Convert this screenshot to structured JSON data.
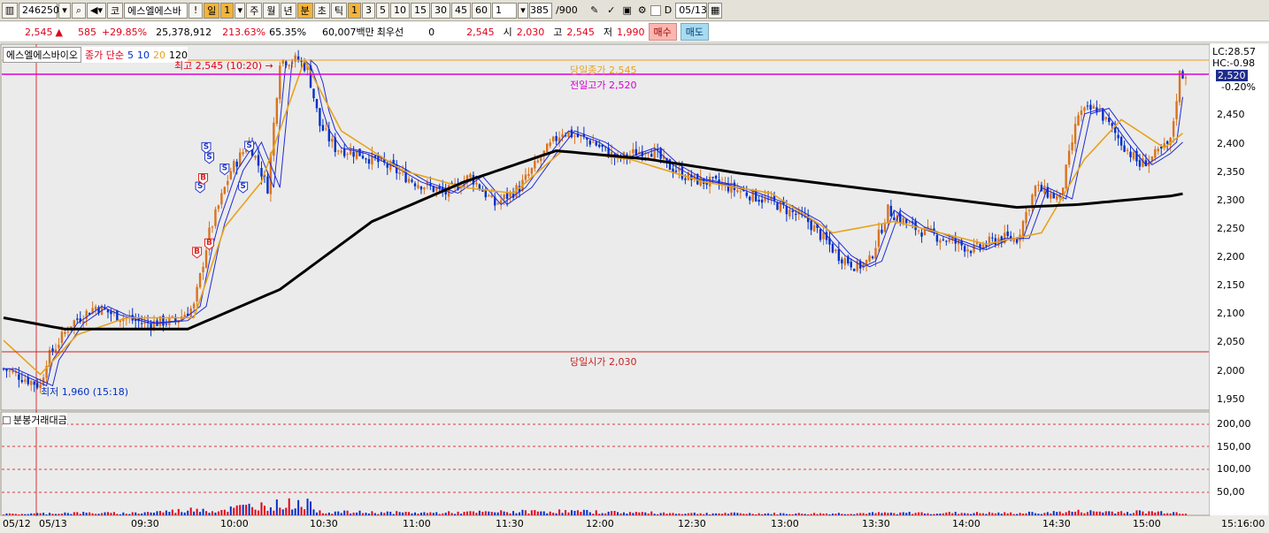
{
  "toolbar": {
    "code": "246250",
    "market_btn": "코",
    "stock_name": "에스엘에스바",
    "alert_btn": "!",
    "period_day": "일",
    "period_day_num": "1",
    "period_week": "주",
    "period_month": "월",
    "period_year": "년",
    "period_min": "분",
    "period_tick": "초",
    "period_tick2": "틱",
    "intervals": [
      "1",
      "3",
      "5",
      "10",
      "15",
      "30",
      "45",
      "60"
    ],
    "interval_value": "1",
    "count_value": "385",
    "count_total": "/900",
    "date_value": "05/13"
  },
  "quote": {
    "price": "2,545",
    "change": "585",
    "change_pct": "+29.85%",
    "volume": "25,378,912",
    "volume_ratio": "213.63%",
    "rate": "65.35%",
    "amount": "60,007백만",
    "best_label": "최우선",
    "best_value": "0",
    "last": "2,545",
    "open_label": "시",
    "open": "2,030",
    "high_label": "고",
    "high": "2,545",
    "low_label": "저",
    "low": "1,990",
    "buy_button": "매수",
    "sell_button": "매도"
  },
  "legend": {
    "stock": "에스엘에스바이오",
    "ma_label": "종가 단순",
    "ma_periods": [
      "5",
      "10",
      "20",
      "120"
    ]
  },
  "annotations": {
    "high_marker": "최고 2,545 (10:20)",
    "low_marker": "최저 1,960 (15:18)",
    "today_close": "당일종가 2,545",
    "prev_high": "전일고가 2,520",
    "today_open": "당일시가 2,030",
    "lc": "LC:28.57",
    "hc": "HC:-0.98",
    "cur_price": "2,520",
    "cur_pct": "-0.20%"
  },
  "volume_panel": {
    "title": "분봉거래대금"
  },
  "signals": [
    "S",
    "S",
    "S",
    "S",
    "S",
    "S",
    "B",
    "B",
    "B"
  ],
  "colors": {
    "up": "#e0001a",
    "down": "#0030c8",
    "ma5": "#1f2bd6",
    "ma10": "#1f2bd6",
    "ma20": "#e8a21c",
    "ma120": "#000000",
    "close_line": "#e8a21c",
    "prev_high_line": "#e000e0",
    "open_line": "#cc2222"
  },
  "chart_data": {
    "type": "candlestick",
    "y_ticks": [
      "2,520",
      "2,450",
      "2,400",
      "2,350",
      "2,300",
      "2,250",
      "2,200",
      "2,150",
      "2,100",
      "2,050",
      "2,000",
      "1,950"
    ],
    "ylim": [
      1930,
      2570
    ],
    "vol_ticks": [
      "200,00",
      "150,00",
      "100,00",
      "50,00"
    ],
    "x_labels": [
      "05/12",
      "05/13",
      "09:30",
      "10:00",
      "10:30",
      "11:00",
      "11:30",
      "12:00",
      "12:30",
      "13:00",
      "13:30",
      "14:00",
      "14:30",
      "15:00",
      "15:16:00"
    ],
    "price_path": [
      [
        0,
        2000
      ],
      [
        6,
        1985
      ],
      [
        12,
        1970
      ],
      [
        14,
        2015
      ],
      [
        22,
        2080
      ],
      [
        30,
        2110
      ],
      [
        36,
        2095
      ],
      [
        46,
        2080
      ],
      [
        56,
        2085
      ],
      [
        62,
        2110
      ],
      [
        67,
        2240
      ],
      [
        74,
        2350
      ],
      [
        80,
        2400
      ],
      [
        86,
        2320
      ],
      [
        90,
        2545
      ],
      [
        96,
        2545
      ],
      [
        99,
        2530
      ],
      [
        103,
        2430
      ],
      [
        108,
        2390
      ],
      [
        116,
        2380
      ],
      [
        126,
        2355
      ],
      [
        134,
        2330
      ],
      [
        144,
        2310
      ],
      [
        152,
        2340
      ],
      [
        160,
        2290
      ],
      [
        168,
        2320
      ],
      [
        176,
        2380
      ],
      [
        182,
        2420
      ],
      [
        192,
        2400
      ],
      [
        200,
        2370
      ],
      [
        210,
        2390
      ],
      [
        216,
        2360
      ],
      [
        224,
        2335
      ],
      [
        234,
        2325
      ],
      [
        242,
        2310
      ],
      [
        252,
        2290
      ],
      [
        262,
        2260
      ],
      [
        272,
        2200
      ],
      [
        278,
        2180
      ],
      [
        282,
        2190
      ],
      [
        288,
        2280
      ],
      [
        296,
        2250
      ],
      [
        306,
        2230
      ],
      [
        316,
        2210
      ],
      [
        324,
        2230
      ],
      [
        330,
        2230
      ],
      [
        336,
        2320
      ],
      [
        344,
        2300
      ],
      [
        350,
        2450
      ],
      [
        356,
        2460
      ],
      [
        364,
        2400
      ],
      [
        370,
        2360
      ],
      [
        376,
        2380
      ],
      [
        380,
        2400
      ],
      [
        383,
        2520
      ],
      [
        385,
        2520
      ]
    ],
    "ma20_path": [
      [
        0,
        2050
      ],
      [
        12,
        1990
      ],
      [
        24,
        2060
      ],
      [
        40,
        2090
      ],
      [
        62,
        2090
      ],
      [
        72,
        2250
      ],
      [
        84,
        2330
      ],
      [
        98,
        2545
      ],
      [
        110,
        2420
      ],
      [
        130,
        2350
      ],
      [
        150,
        2320
      ],
      [
        166,
        2310
      ],
      [
        182,
        2385
      ],
      [
        204,
        2370
      ],
      [
        228,
        2330
      ],
      [
        250,
        2310
      ],
      [
        270,
        2240
      ],
      [
        290,
        2260
      ],
      [
        320,
        2220
      ],
      [
        338,
        2240
      ],
      [
        352,
        2370
      ],
      [
        364,
        2440
      ],
      [
        378,
        2390
      ],
      [
        385,
        2420
      ]
    ],
    "ma120_path": [
      [
        0,
        2090
      ],
      [
        20,
        2070
      ],
      [
        60,
        2070
      ],
      [
        90,
        2140
      ],
      [
        120,
        2260
      ],
      [
        150,
        2330
      ],
      [
        180,
        2385
      ],
      [
        210,
        2370
      ],
      [
        240,
        2345
      ],
      [
        270,
        2325
      ],
      [
        300,
        2305
      ],
      [
        330,
        2285
      ],
      [
        350,
        2290
      ],
      [
        380,
        2305
      ],
      [
        385,
        2310
      ]
    ],
    "volume_bars": [
      [
        0,
        3
      ],
      [
        10,
        4
      ],
      [
        20,
        6
      ],
      [
        40,
        5
      ],
      [
        60,
        12
      ],
      [
        64,
        18
      ],
      [
        68,
        10
      ],
      [
        80,
        22
      ],
      [
        98,
        30
      ],
      [
        104,
        8
      ],
      [
        140,
        6
      ],
      [
        180,
        10
      ],
      [
        220,
        5
      ],
      [
        260,
        4
      ],
      [
        300,
        6
      ],
      [
        330,
        5
      ],
      [
        350,
        9
      ],
      [
        380,
        8
      ],
      [
        384,
        6
      ]
    ]
  }
}
